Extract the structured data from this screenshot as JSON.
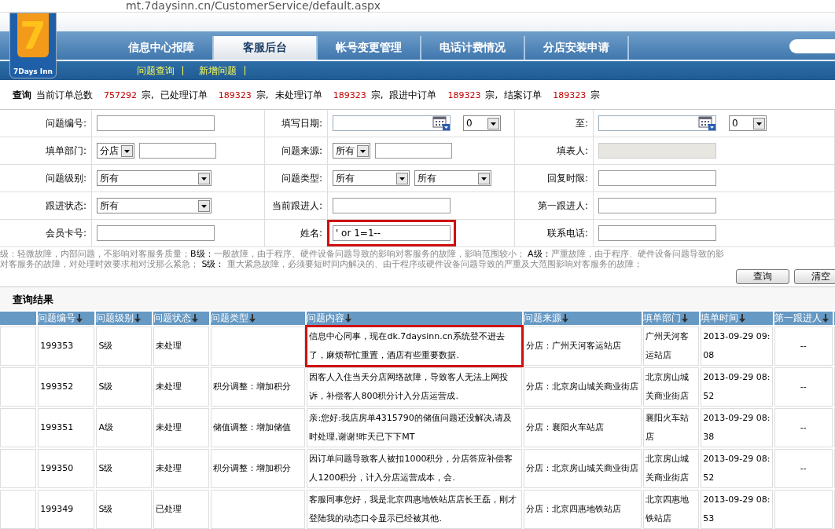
{
  "address_bar": {
    "url": "mt.7daysinn.cn/CustomerService/default.aspx"
  },
  "logo": {
    "digit": "7",
    "text": "7Days Inn"
  },
  "nav": [
    {
      "label": "信息中心报障",
      "selected": false
    },
    {
      "label": "客服后台",
      "selected": true
    },
    {
      "label": "帐号变更管理",
      "selected": false
    },
    {
      "label": "电话计费情况",
      "selected": false
    },
    {
      "label": "分店安装申请",
      "selected": false
    }
  ],
  "subnav": [
    "问题查询",
    "新增问题"
  ],
  "stats": {
    "title": "查询",
    "items": [
      {
        "label": "当前订单总数",
        "count": "757292",
        "unit": "宗,"
      },
      {
        "label": "已处理订单",
        "count": "189323",
        "unit": "宗,"
      },
      {
        "label": "未处理订单",
        "count": "189323",
        "unit": "宗,"
      },
      {
        "label": "跟进中订单",
        "count": "189323",
        "unit": "宗,"
      },
      {
        "label": "结案订单",
        "count": "189323",
        "unit": "宗"
      }
    ]
  },
  "form": {
    "rows": [
      [
        {
          "label": "问题编号:",
          "fields": [
            {
              "kind": "text"
            }
          ]
        },
        {
          "label": "填写日期:",
          "fields": [
            {
              "kind": "date"
            },
            {
              "kind": "select",
              "value": "0"
            }
          ]
        },
        {
          "label": "至:",
          "fields": [
            {
              "kind": "date"
            },
            {
              "kind": "select",
              "value": "0"
            }
          ]
        }
      ],
      [
        {
          "label": "填单部门:",
          "fields": [
            {
              "kind": "select",
              "value": "分店"
            },
            {
              "kind": "text"
            }
          ]
        },
        {
          "label": "问题来源:",
          "fields": [
            {
              "kind": "select",
              "value": "所有"
            },
            {
              "kind": "text"
            }
          ]
        },
        {
          "label": "填表人:",
          "fields": [
            {
              "kind": "readonly"
            }
          ]
        }
      ],
      [
        {
          "label": "问题级别:",
          "fields": [
            {
              "kind": "select",
              "value": "所有"
            }
          ]
        },
        {
          "label": "问题类型:",
          "fields": [
            {
              "kind": "select",
              "value": "所有"
            },
            {
              "kind": "select",
              "value": "所有"
            }
          ]
        },
        {
          "label": "回复时限:",
          "fields": [
            {
              "kind": "text"
            }
          ]
        }
      ],
      [
        {
          "label": "跟进状态:",
          "fields": [
            {
              "kind": "select",
              "value": "所有"
            }
          ]
        },
        {
          "label": "当前跟进人:",
          "fields": [
            {
              "kind": "text"
            }
          ]
        },
        {
          "label": "第一跟进人:",
          "fields": [
            {
              "kind": "text"
            }
          ]
        }
      ],
      [
        {
          "label": "会员卡号:",
          "fields": [
            {
              "kind": "text"
            }
          ]
        },
        {
          "label": "姓名:",
          "highlighted": true,
          "fields": [
            {
              "kind": "text",
              "value": "' or 1=1--"
            }
          ]
        },
        {
          "label": "联系电话:",
          "fields": [
            {
              "kind": "text"
            }
          ]
        }
      ]
    ]
  },
  "legend": [
    "级：轻微故障，内部问题，不影响对客服务质量；**B级：**一般故障，由于程序、硬件设备问题导致的影响对客服务的故障，影响范围较小；  **A级：**严重故障，由于程序、硬件设备问题导致的影",
    "对客服务的故障，对处理时效要求相对没那么紧急；  **S级：**  重大紧急故障，必须要短时间内解决的、由于程序或硬件设备问题导致的严重及大范围影响对客服务的故障；"
  ],
  "buttons": [
    "查询",
    "清空"
  ],
  "results": {
    "title": "查询结果",
    "columns": [
      "问题编号",
      "问题级别",
      "问题状态",
      "问题类型",
      "问题内容",
      "问题来源",
      "填单部门",
      "填单时间",
      "第一跟进人"
    ],
    "rows": [
      {
        "cells": [
          "199353",
          "S级",
          "未处理",
          "",
          "信息中心同事，现在dk.7daysinn.cn系统登不进去了，麻烦帮忙重置，酒店有些重要数据.",
          "分店：广州天河客运站店",
          "广州天河客运站店",
          "2013-09-29 09:08",
          "--"
        ],
        "highlighted": true
      },
      {
        "cells": [
          "199352",
          "S级",
          "未处理",
          "积分调整：增加积分",
          "因客人入住当天分店网络故障，导致客人无法上网投诉，补偿客人800积分计入分店运营成.",
          "分店：北京房山城关商业街店",
          "北京房山城关商业街店",
          "2013-09-29 08:52",
          "--"
        ],
        "highlighted": false
      },
      {
        "cells": [
          "199351",
          "A级",
          "未处理",
          "储值调整：增加储值",
          "亲:您好:我店房单4315790的储值问题还没解决,请及时处理,谢谢!昨天已下下MT",
          "分店：襄阳火车站店",
          "襄阳火车站店",
          "2013-09-29 08:38",
          "--"
        ],
        "highlighted": false
      },
      {
        "cells": [
          "199350",
          "S级",
          "未处理",
          "积分调整：增加积分",
          "因订单问题导致客人被扣1000积分，分店答应补偿客人1200积分，计入分店运营成本，会.",
          "分店：北京房山城关商业街店",
          "北京房山城关商业街店",
          "2013-09-29 08:52",
          "--"
        ],
        "highlighted": false
      },
      {
        "cells": [
          "199349",
          "S级",
          "已处理",
          "",
          "客服同事您好，我是北京四惠地铁站店店长王磊，刚才登陆我的动态口令显示已经被其他.",
          "分店：北京四惠地铁站店",
          "北京四惠地铁站店",
          "2013-09-29 08:53",
          ""
        ],
        "highlighted": false
      }
    ]
  }
}
